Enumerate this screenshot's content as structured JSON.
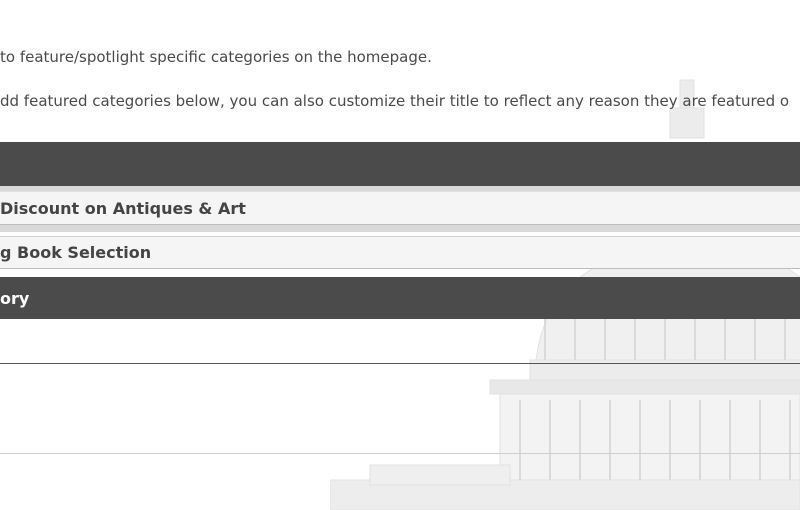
{
  "intro": {
    "line1": "to feature/spotlight specific categories on the homepage.",
    "line2": "dd featured categories below, you can also customize their title to reflect any reason they are featured o"
  },
  "featured": {
    "rows": [
      {
        "title": "Discount on Antiques & Art"
      },
      {
        "title": "g Book Selection"
      }
    ]
  },
  "add_section": {
    "title": "ory"
  },
  "colors": {
    "header_bar": "#4b4b4b",
    "row_bg": "#f5f5f5",
    "text": "#444444"
  }
}
